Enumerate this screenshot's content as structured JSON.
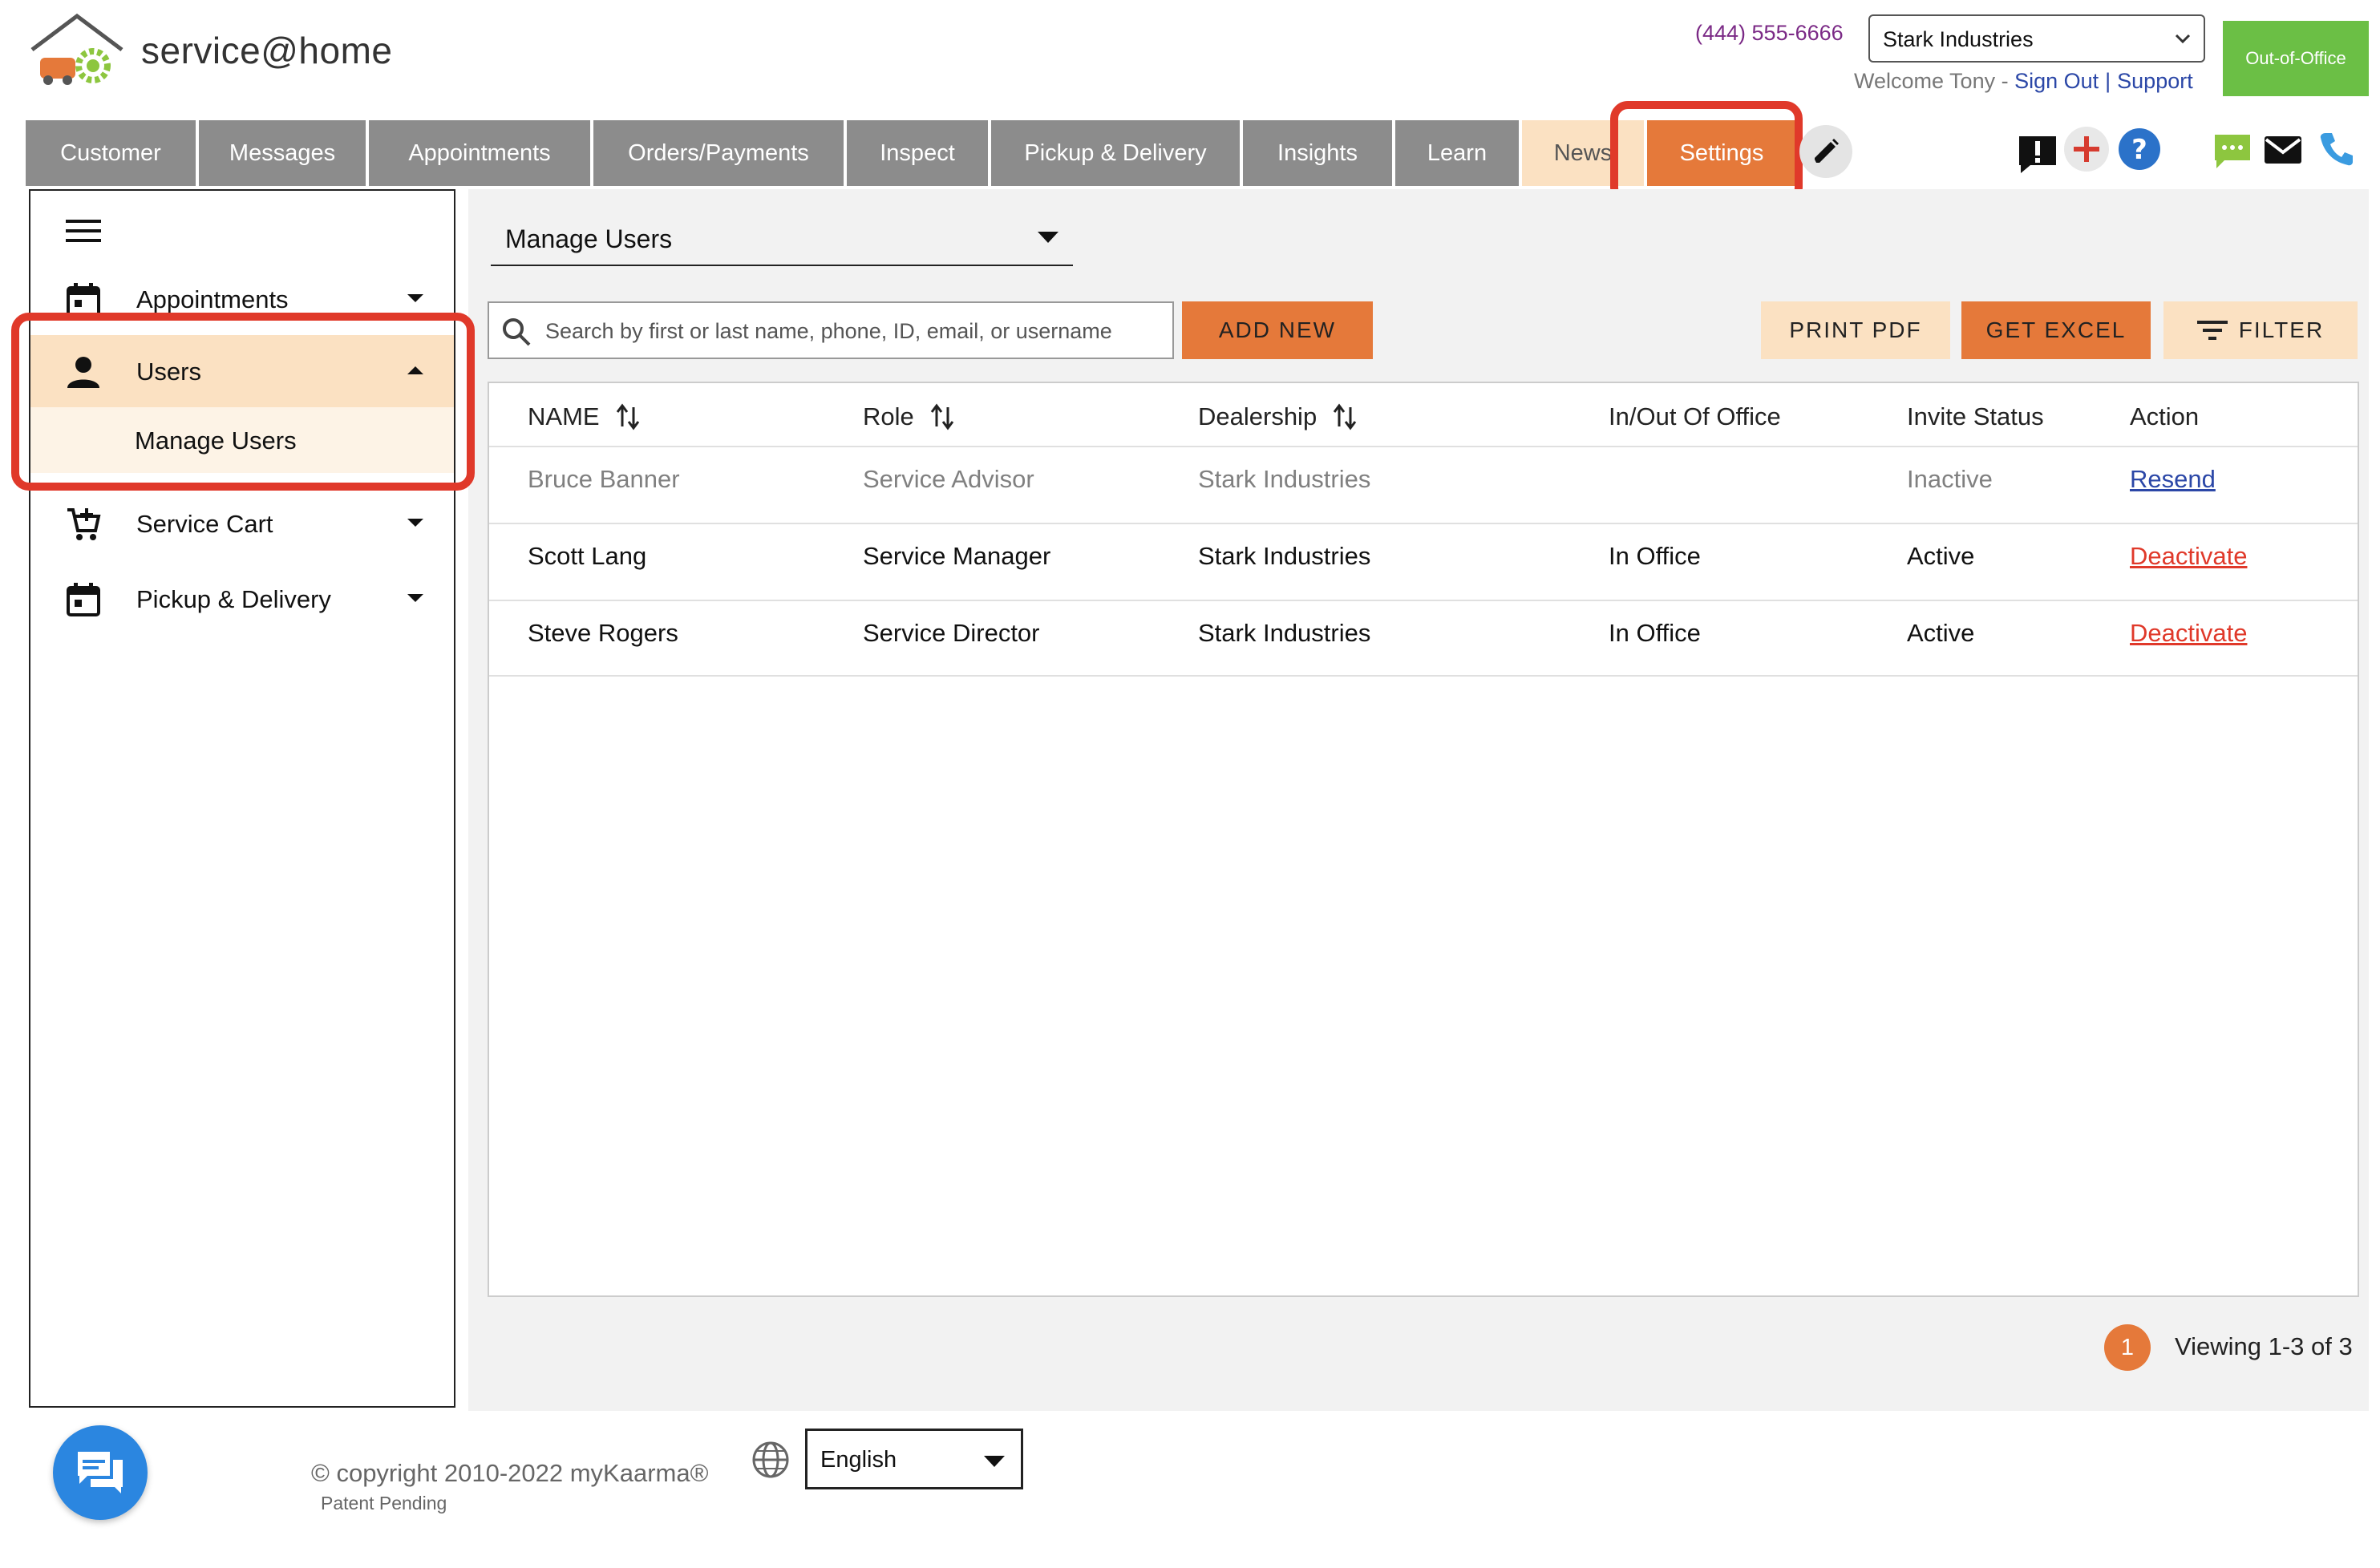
{
  "brand": {
    "name": "service@home"
  },
  "header": {
    "phone": "(444) 555-6666",
    "dealer_selected": "Stark Industries",
    "out_of_office_label": "Out-of-Office",
    "welcome_text": "Welcome Tony - ",
    "sign_out": "Sign Out",
    "separator": "|",
    "support": "Support"
  },
  "tabs": [
    {
      "label": "Customer",
      "state": "default"
    },
    {
      "label": "Messages",
      "state": "default"
    },
    {
      "label": "Appointments",
      "state": "default"
    },
    {
      "label": "Orders/Payments",
      "state": "default"
    },
    {
      "label": "Inspect",
      "state": "default"
    },
    {
      "label": "Pickup & Delivery",
      "state": "default"
    },
    {
      "label": "Insights",
      "state": "default"
    },
    {
      "label": "Learn",
      "state": "default"
    },
    {
      "label": "News",
      "state": "highlight"
    },
    {
      "label": "Settings",
      "state": "active"
    }
  ],
  "sidebar": {
    "items": [
      {
        "label": "Appointments",
        "icon": "calendar-icon"
      },
      {
        "label": "Users",
        "icon": "person-icon",
        "expanded": true
      },
      {
        "label": "Service Cart",
        "icon": "cart-icon"
      },
      {
        "label": "Pickup & Delivery",
        "icon": "calendar-icon"
      }
    ],
    "subitems": [
      {
        "label": "Manage Users"
      }
    ]
  },
  "main": {
    "view_select": "Manage Users",
    "search_placeholder": "Search by first or last name, phone, ID, email, or username",
    "add_new": "ADD NEW",
    "print_pdf": "PRINT PDF",
    "get_excel": "GET EXCEL",
    "filter": "FILTER"
  },
  "table": {
    "columns": [
      "NAME",
      "Role",
      "Dealership",
      "In/Out Of Office",
      "Invite Status",
      "Action"
    ],
    "rows": [
      {
        "name": "Bruce Banner",
        "role": "Service Advisor",
        "dealership": "Stark Industries",
        "office": "",
        "status": "Inactive",
        "action": "Resend"
      },
      {
        "name": "Scott Lang",
        "role": "Service Manager",
        "dealership": "Stark Industries",
        "office": "In Office",
        "status": "Active",
        "action": "Deactivate"
      },
      {
        "name": "Steve Rogers",
        "role": "Service Director",
        "dealership": "Stark Industries",
        "office": "In Office",
        "status": "Active",
        "action": "Deactivate"
      }
    ]
  },
  "pagination": {
    "page": "1",
    "viewing": "Viewing 1-3 of 3"
  },
  "footer": {
    "copyright": "© copyright 2010-2022 myKaarma®",
    "patent": "Patent Pending",
    "language": "English"
  },
  "colors": {
    "accent": "#e5793a",
    "accent_light": "#fbe1c2",
    "tab_gray": "#8c8c8c",
    "highlight_red": "#e0392a",
    "link_blue": "#2b47a7",
    "ooo_green": "#6bbf45",
    "chat_blue": "#2b86e0"
  }
}
